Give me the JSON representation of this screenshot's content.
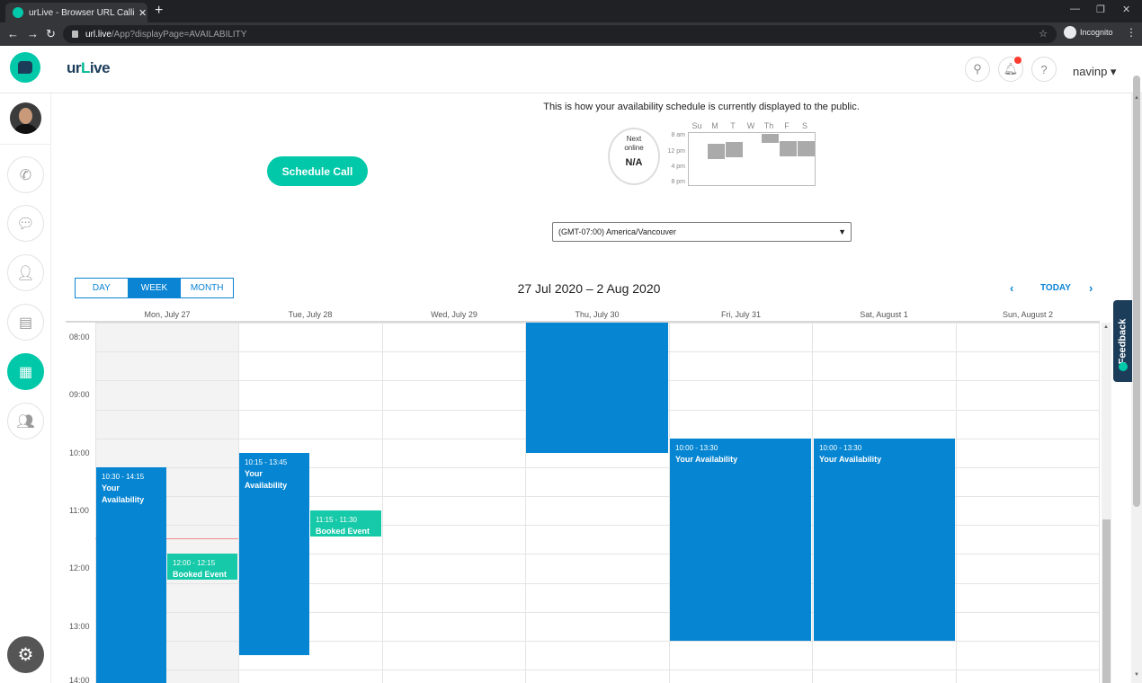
{
  "browser": {
    "tab_title": "urLive - Browser URL Calling Vide",
    "tab_close": "✕",
    "new_tab": "+",
    "url_host": "url.live",
    "url_path": "/App?displayPage=AVAILABILITY",
    "incognito_label": "Incognito"
  },
  "header": {
    "brand_prefix": "ur",
    "brand_accent": "L",
    "brand_suffix": "ive",
    "username": "navinp ▾"
  },
  "availability": {
    "schedule_button": "Schedule Call",
    "public_text": "This is how your availability schedule is currently displayed to the public.",
    "next_online_label_1": "Next",
    "next_online_label_2": "online",
    "next_online_value": "N/A",
    "mini_days": [
      "Su",
      "M",
      "T",
      "W",
      "Th",
      "F",
      "S"
    ],
    "mini_times": [
      "8 am",
      "12 pm",
      "4 pm",
      "8 pm"
    ],
    "timezone": "(GMT-07:00) America/Vancouver"
  },
  "calendar": {
    "views": [
      "DAY",
      "WEEK",
      "MONTH"
    ],
    "selected_view": "WEEK",
    "range_title": "27 Jul 2020 – 2 Aug 2020",
    "today_label": "TODAY",
    "prev": "‹",
    "next": "›",
    "days": [
      "Mon, July 27",
      "Tue, July 28",
      "Wed, July 29",
      "Thu, July 30",
      "Fri, July 31",
      "Sat, August 1",
      "Sun, August 2"
    ],
    "times": [
      "08:00",
      "09:00",
      "10:00",
      "11:00",
      "12:00",
      "13:00",
      "14:00"
    ],
    "events": {
      "mon_avail": {
        "time": "10:30 - 14:15",
        "name": "Your Availability"
      },
      "mon_booked": {
        "time": "12:00 - 12:15",
        "name": "Booked Event"
      },
      "tue_avail": {
        "time": "10:15 - 13:45",
        "name": "Your Availability"
      },
      "tue_booked": {
        "time": "11:15 - 11:30",
        "name": "Booked Event"
      },
      "fri_avail": {
        "time": "10:00 - 13:30",
        "name": "Your Availability"
      },
      "sat_avail": {
        "time": "10:00 - 13:30",
        "name": "Your Availability"
      }
    }
  },
  "feedback": "Feedback",
  "colors": {
    "brand_teal": "#00c8a8",
    "availability_blue": "#0585d2",
    "booked_green": "#16c9a8",
    "link_blue": "#0b84d3"
  },
  "icons": [
    "phone-icon",
    "chat-icon",
    "contact-icon",
    "document-icon",
    "calendar-icon",
    "group-icon",
    "gear-icon",
    "search-icon",
    "bell-icon",
    "help-icon"
  ]
}
